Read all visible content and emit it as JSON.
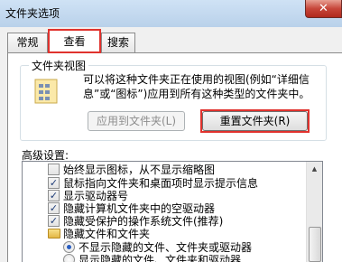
{
  "window": {
    "title": "文件夹选项",
    "close_glyph": "✕"
  },
  "tabs": [
    {
      "label": "常规",
      "active": false
    },
    {
      "label": "查看",
      "active": true
    },
    {
      "label": "搜索",
      "active": false
    }
  ],
  "folder_views": {
    "caption": "文件夹视图",
    "description": "可以将这种文件夹正在使用的视图(例如“详细信息”或“图标”)应用到所有这种类型的文件夹中。",
    "apply_button": "应用到文件夹(L)",
    "reset_button": "重置文件夹(R)"
  },
  "advanced": {
    "label": "高级设置:",
    "items": [
      {
        "type": "checkbox",
        "checked": false,
        "label": "始终显示图标，从不显示缩略图"
      },
      {
        "type": "checkbox",
        "checked": true,
        "label": "鼠标指向文件夹和桌面项时显示提示信息"
      },
      {
        "type": "checkbox",
        "checked": true,
        "label": "显示驱动器号"
      },
      {
        "type": "checkbox",
        "checked": true,
        "label": "隐藏计算机文件夹中的空驱动器"
      },
      {
        "type": "checkbox",
        "checked": true,
        "label": "隐藏受保护的操作系统文件(推荐)"
      },
      {
        "type": "folder",
        "label": "隐藏文件和文件夹"
      },
      {
        "type": "radio",
        "checked": true,
        "label": "不显示隐藏的文件、文件夹或驱动器"
      },
      {
        "type": "radio",
        "checked": false,
        "label": "显示隐藏的文件、文件夹和驱动器"
      }
    ]
  },
  "colors": {
    "highlight": "#e0322d",
    "accent": "#2a5ec0"
  }
}
